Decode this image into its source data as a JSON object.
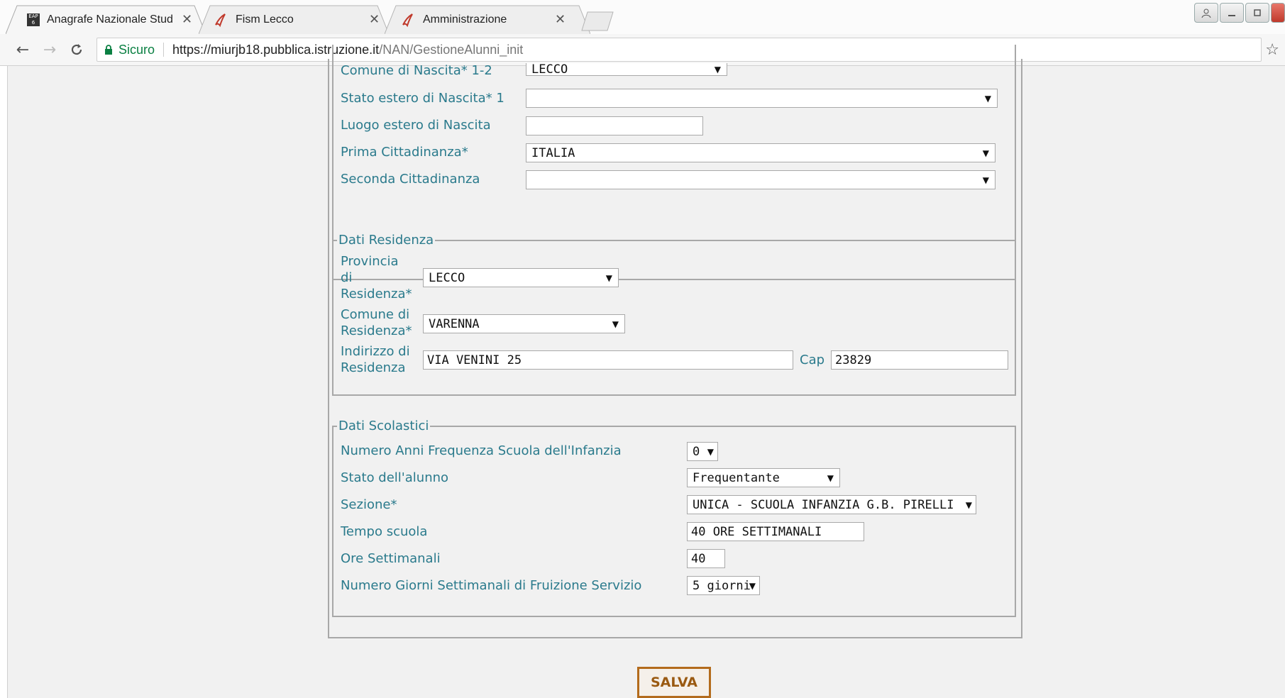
{
  "browser": {
    "tabs": [
      {
        "title": "Anagrafe Nazionale Stud",
        "favicon": "eap-favicon"
      },
      {
        "title": "Fism Lecco",
        "favicon": "pdf-favicon"
      },
      {
        "title": "Amministrazione",
        "favicon": "pdf-favicon"
      }
    ],
    "secure_label": "Sicuro",
    "url_host": "https://miurjb18.pubblica.istruzione.it",
    "url_path": "/NAN/GestioneAlunni_init"
  },
  "nascita": {
    "comune_label": "Comune di Nascita* 1-2",
    "comune_value": "LECCO",
    "stato_estero_label": "Stato estero di Nascita* 1",
    "stato_estero_value": "",
    "luogo_estero_label": "Luogo estero di Nascita",
    "luogo_estero_value": "",
    "prima_cittadinanza_label": "Prima Cittadinanza*",
    "prima_cittadinanza_value": "ITALIA",
    "seconda_cittadinanza_label": "Seconda Cittadinanza",
    "seconda_cittadinanza_value": ""
  },
  "residenza": {
    "legend": "Dati Residenza",
    "provincia_label_1": "Provincia",
    "provincia_label_2": "di",
    "provincia_label_3": "Residenza*",
    "provincia_value": "LECCO",
    "comune_label_1": "Comune di",
    "comune_label_2": "Residenza*",
    "comune_value": "VARENNA",
    "indirizzo_label_1": "Indirizzo di",
    "indirizzo_label_2": "Residenza",
    "indirizzo_value": "VIA VENINI 25",
    "cap_label": "Cap",
    "cap_value": "23829"
  },
  "scolastici": {
    "legend": "Dati Scolastici",
    "anni_infanzia_label": "Numero Anni Frequenza Scuola dell'Infanzia",
    "anni_infanzia_value": "0",
    "stato_alunno_label": "Stato dell'alunno",
    "stato_alunno_value": "Frequentante",
    "sezione_label": "Sezione*",
    "sezione_value": "UNICA - SCUOLA INFANZIA G.B. PIRELLI",
    "tempo_scuola_label": "Tempo scuola",
    "tempo_scuola_value": "40 ORE SETTIMANALI",
    "ore_settimanali_label": "Ore Settimanali",
    "ore_settimanali_value": "40",
    "giorni_label": "Numero Giorni Settimanali di Fruizione Servizio",
    "giorni_value": "5 giorni"
  },
  "actions": {
    "save_label": "SALVA"
  }
}
